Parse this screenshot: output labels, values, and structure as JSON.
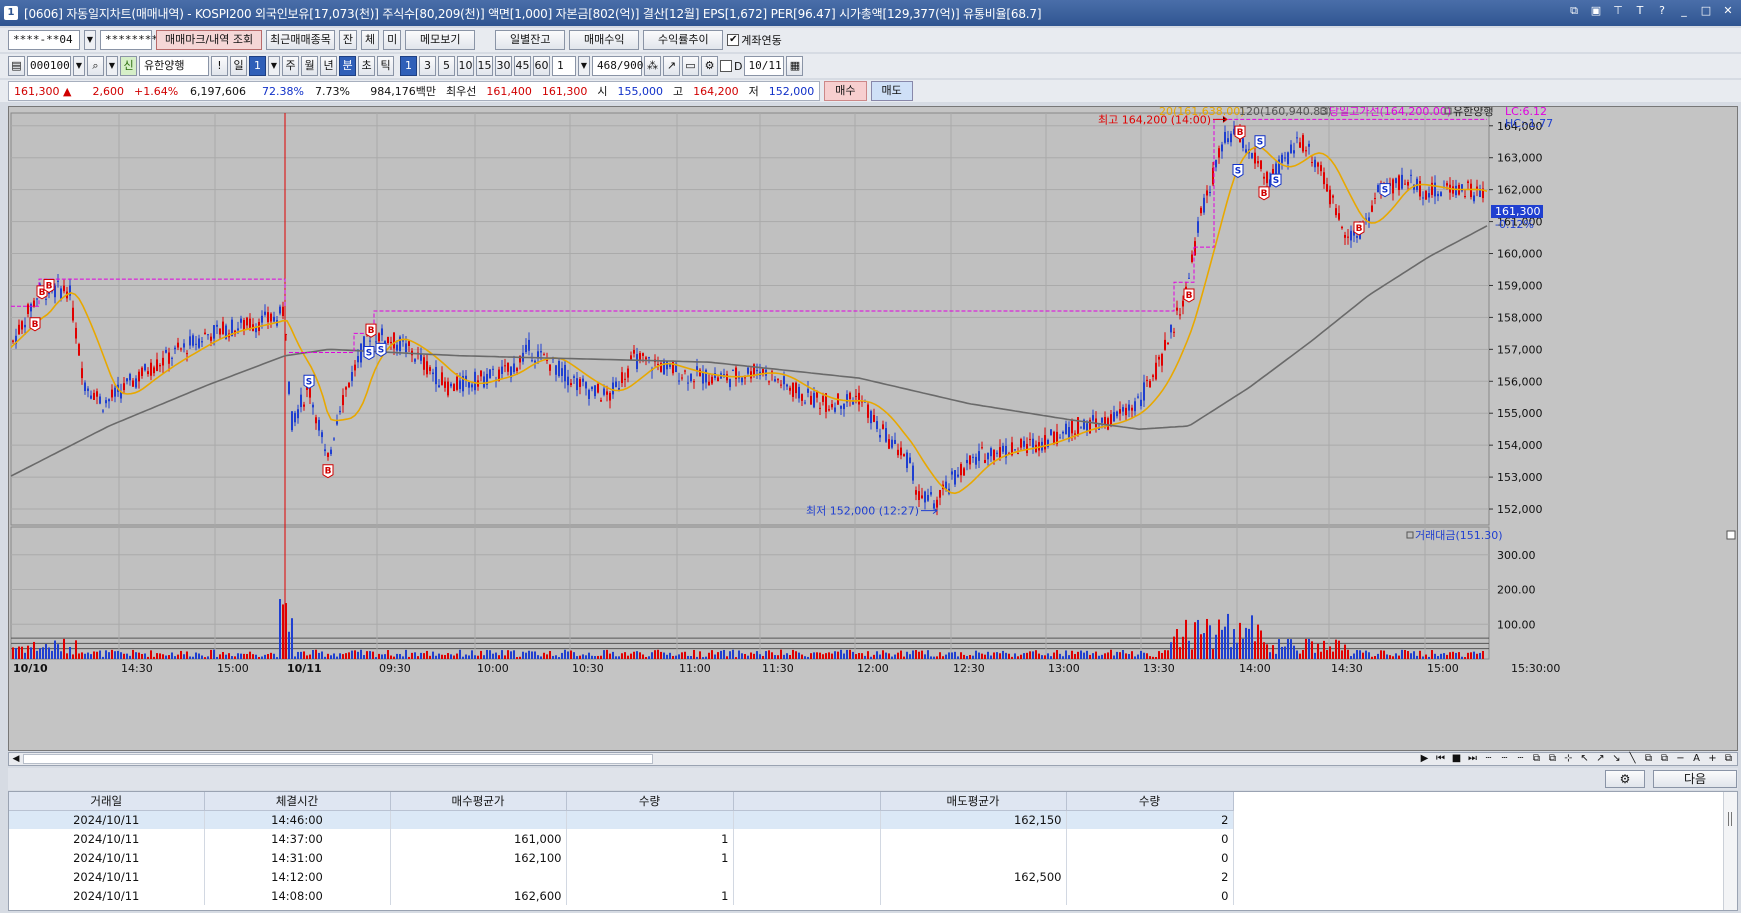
{
  "window": {
    "title": "[0606] 자동일지차트(매매내역) - KOSPI200 외국인보유[17,073(천)] 주식수[80,209(천)] 액면[1,000] 자본금[802(억)] 결산[12월] EPS[1,672] PER[96.47] 시가총액[129,377(억)] 유통비율[68.7]",
    "icon_label": "1"
  },
  "toolbar1": {
    "account": "****-**04",
    "password": "********",
    "btn_trade_marks": "매매마크/내역 조회",
    "btn_recent": "최근매매종목",
    "btn_jan": "잔",
    "btn_che": "체",
    "btn_mi": "미",
    "btn_memo": "메모보기",
    "btn_daily": "일별잔고",
    "btn_profit": "매매수익",
    "btn_return": "수익률추이",
    "link_label": "계좌연동"
  },
  "toolbar2": {
    "code": "000100",
    "shin": "신",
    "stock_name": "유한양행",
    "period_day": "일",
    "period_num": "1",
    "periods": [
      "주",
      "월",
      "년",
      "분",
      "초",
      "틱"
    ],
    "intervals": [
      "1",
      "3",
      "5",
      "10",
      "15",
      "30",
      "45",
      "60"
    ],
    "count_value": "1",
    "range": "468/900",
    "date_value": "10/11",
    "d_label": "D"
  },
  "quote": {
    "price": "161,300 ▲",
    "change": "2,600",
    "change_pct": "+1.64%",
    "volume": "6,197,606",
    "ratio1": "72.38%",
    "ratio2": "7.73%",
    "amount": "984,176백만",
    "best_label": "최우선",
    "ask": "161,400",
    "bid": "161,300",
    "open_label": "시",
    "open": "155,000",
    "high_label": "고",
    "high": "164,200",
    "low_label": "저",
    "low": "152,000",
    "buy_btn": "매수",
    "sell_btn": "매도"
  },
  "chart": {
    "legend_ma20": "20(161,638.00)",
    "legend_ma120": "120(160,940.83)",
    "legend_prevhigh": "당일고가선(164,200.00)",
    "legend_name": "유한양행",
    "lc_label": "LC:6.12",
    "hc_label": "HC:-1.77",
    "high_annot": "최고 164,200 (14:00)",
    "low_annot": "최저 152,000 (12:27)",
    "current_price": "161,300",
    "current_pct": "-0.12%",
    "volume_legend": "거래대금(151.30)",
    "price_ticks": [
      "164,000",
      "163,000",
      "162,000",
      "161,000",
      "160,000",
      "159,000",
      "158,000",
      "157,000",
      "156,000",
      "155,000",
      "154,000",
      "153,000",
      "152,000"
    ],
    "volume_ticks": [
      "300.00",
      "200.00",
      "100.00"
    ],
    "time_labels": [
      "10/10",
      "14:30",
      "15:00",
      "10/11",
      "09:30",
      "10:00",
      "10:30",
      "11:00",
      "11:30",
      "12:00",
      "12:30",
      "13:00",
      "13:30",
      "14:00",
      "14:30",
      "15:00",
      "15:30:00"
    ],
    "colors": {
      "up": "#e00000",
      "down": "#1f3fd0",
      "ma20": "#e8a800",
      "ma120": "#6a6a6a",
      "line": "#e000e0"
    }
  },
  "chart_data": {
    "type": "candlestick",
    "x": [
      "10/10 14:05",
      "10/10 14:30",
      "10/10 15:00",
      "10/10 15:20",
      "10/11 09:00",
      "10/11 09:30",
      "10/11 10:00",
      "10/11 10:30",
      "10/11 11:00",
      "10/11 11:30",
      "10/11 12:00",
      "10/11 12:27",
      "10/11 12:30",
      "10/11 13:00",
      "10/11 13:30",
      "10/11 14:00",
      "10/11 14:30",
      "10/11 15:00",
      "10/11 15:20"
    ],
    "close": [
      157,
      156,
      158,
      158.3,
      155,
      157.3,
      156.3,
      156.6,
      156.3,
      155.8,
      154.3,
      152.2,
      153.3,
      154.5,
      156.5,
      163.5,
      161.5,
      162.2,
      161.3
    ],
    "ylim": [
      151.5,
      164.4
    ],
    "high": 164200,
    "low": 152000
  },
  "buttons": {
    "next": "다음",
    "settings_icon": "gear-icon"
  },
  "table": {
    "columns": [
      "거래일",
      "체결시간",
      "매수평균가",
      "수량",
      "",
      "매도평균가",
      "수량"
    ],
    "rows": [
      [
        "2024/10/11",
        "14:46:00",
        "",
        "",
        "",
        "162,150",
        "2"
      ],
      [
        "2024/10/11",
        "14:37:00",
        "161,000",
        "1",
        "",
        "",
        "0"
      ],
      [
        "2024/10/11",
        "14:31:00",
        "162,100",
        "1",
        "",
        "",
        "0"
      ],
      [
        "2024/10/11",
        "14:12:00",
        "",
        "",
        "",
        "162,500",
        "2"
      ],
      [
        "2024/10/11",
        "14:08:00",
        "162,600",
        "1",
        "",
        "",
        "0"
      ]
    ]
  }
}
